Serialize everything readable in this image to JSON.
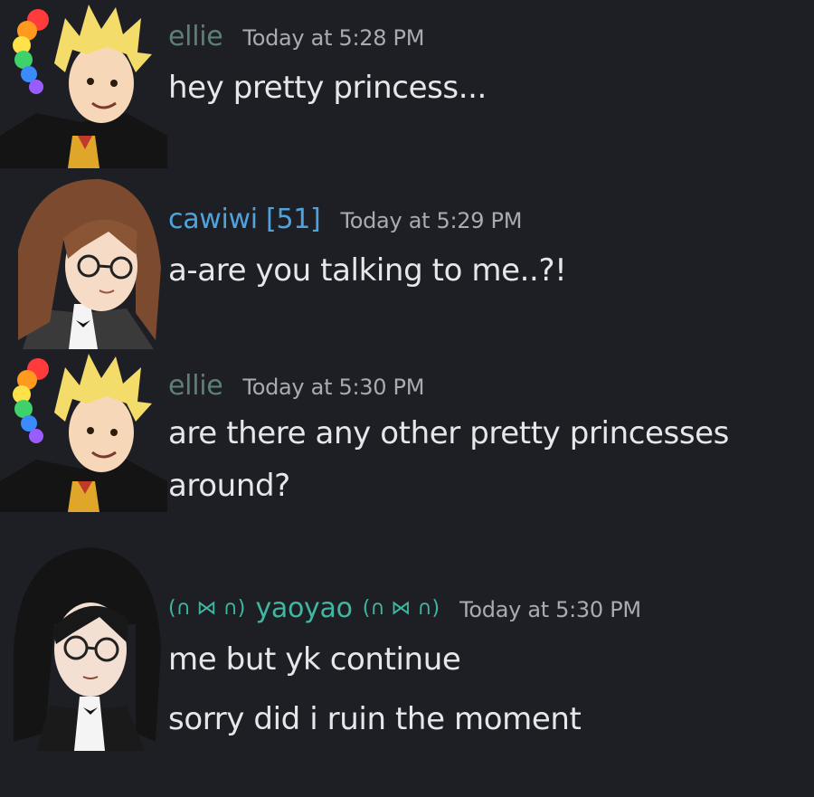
{
  "colors": {
    "background": "#1e1f24",
    "ellie_name": "#5e7f74",
    "cawiwi_name": "#4fa3dc",
    "yaoyao_name": "#3fb7a2",
    "timestamp": "#a9abb2",
    "message_text": "#e6e7ea"
  },
  "messages": [
    {
      "author": "ellie",
      "timestamp": "Today at 5:28 PM",
      "avatar_icon": "blonde-character-avatar-icon",
      "lines": [
        "hey pretty princess..."
      ]
    },
    {
      "author": "cawiwi [51]",
      "timestamp": "Today at 5:29 PM",
      "avatar_icon": "brown-haired-glasses-avatar-icon",
      "lines": [
        "a-are you talking to me..?!"
      ]
    },
    {
      "author": "ellie",
      "timestamp": "Today at 5:30 PM",
      "avatar_icon": "blonde-character-avatar-icon",
      "lines": [
        "are there any other pretty princesses",
        "around?"
      ]
    },
    {
      "author": "yaoyao",
      "author_prefix": "(∩ ⋈ ∩)",
      "author_suffix": "(∩ ⋈ ∩)",
      "timestamp": "Today at 5:30 PM",
      "avatar_icon": "black-haired-glasses-avatar-icon",
      "lines": [
        "me but yk continue",
        "sorry did i ruin the moment"
      ]
    }
  ]
}
